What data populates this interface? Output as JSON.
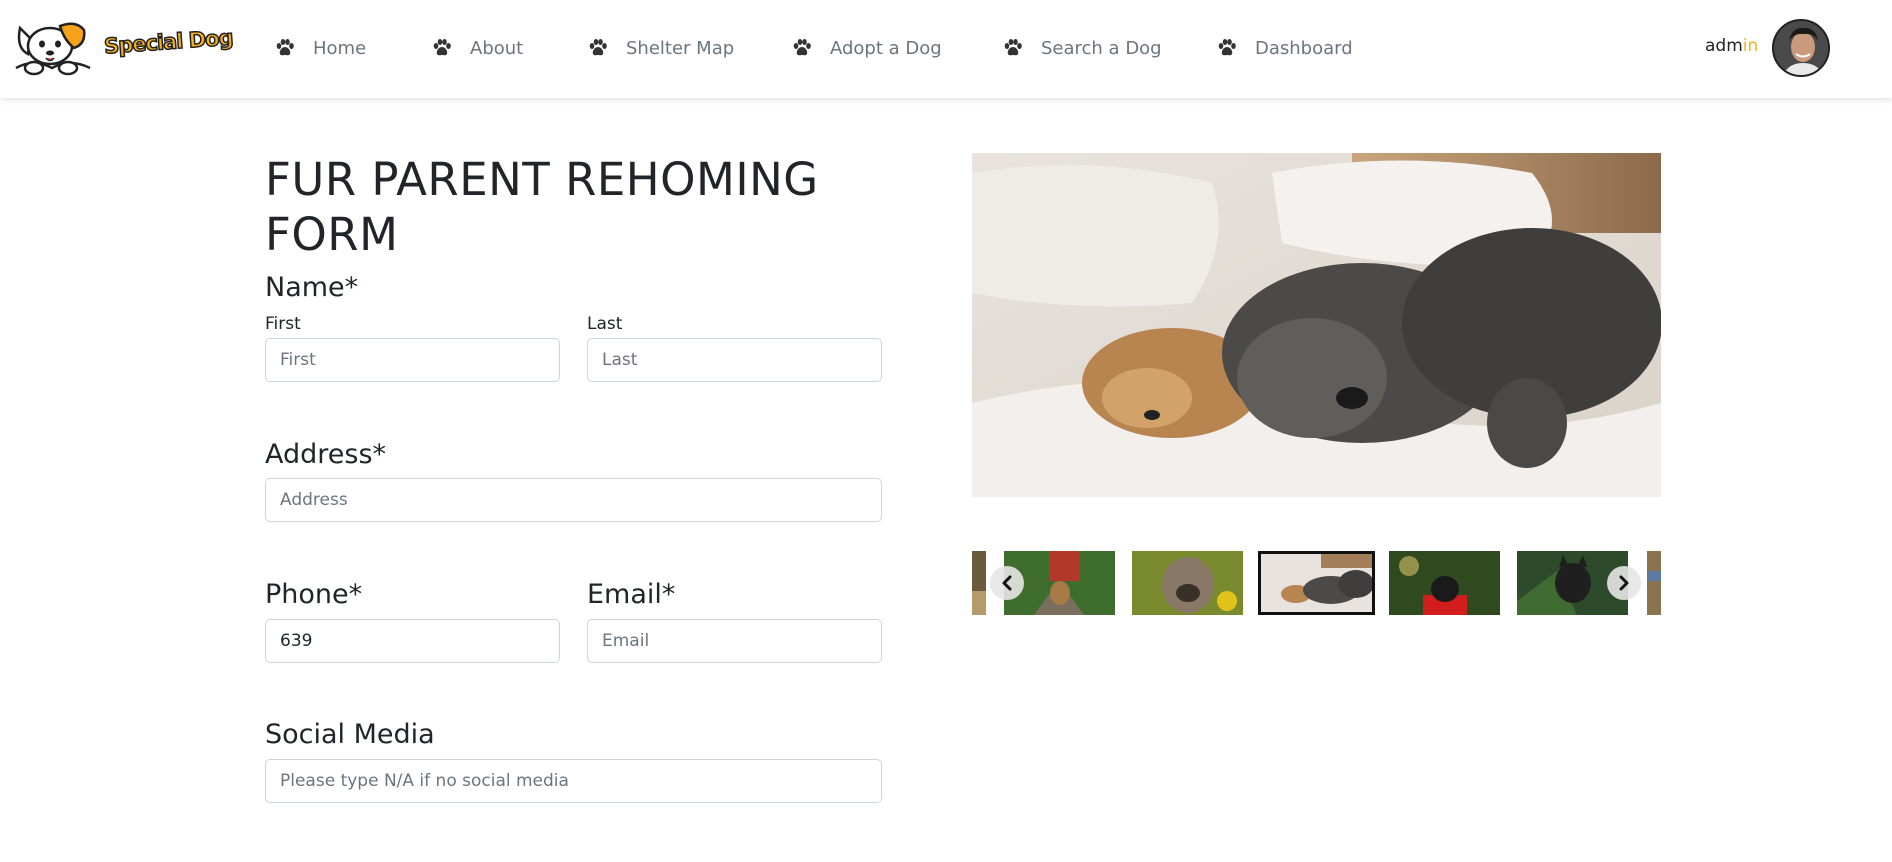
{
  "brand": {
    "name": "Special Dog"
  },
  "nav": {
    "items": [
      {
        "label": "Home"
      },
      {
        "label": "About"
      },
      {
        "label": "Shelter Map"
      },
      {
        "label": "Adopt a Dog"
      },
      {
        "label": "Search a Dog"
      },
      {
        "label": "Dashboard"
      }
    ]
  },
  "user": {
    "name_part1": "adm",
    "name_part2": "in"
  },
  "form": {
    "title": "FUR PARENT REHOMING FORM",
    "name": {
      "label": "Name*",
      "first_label": "First",
      "first_placeholder": "First",
      "last_label": "Last",
      "last_placeholder": "Last"
    },
    "address": {
      "label": "Address*",
      "placeholder": "Address"
    },
    "phone": {
      "label": "Phone*",
      "value": "639"
    },
    "email": {
      "label": "Email*",
      "placeholder": "Email"
    },
    "social": {
      "label": "Social Media",
      "placeholder": "Please type N/A if no social media"
    }
  },
  "colors": {
    "accent": "#f6b21b",
    "nav_text": "#6c757d",
    "heading": "#212529"
  },
  "icons": {
    "nav": "paw-icon",
    "prev": "chevron-left-icon",
    "next": "chevron-right-icon"
  }
}
